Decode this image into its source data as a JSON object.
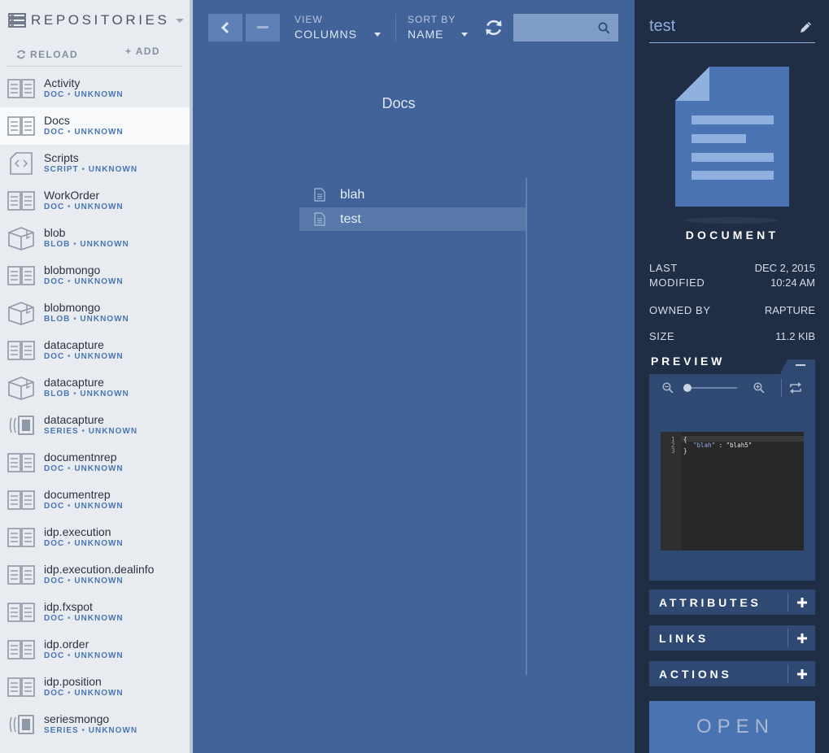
{
  "sidebar": {
    "title": "REPOSITORIES",
    "reload_label": "RELOAD",
    "add_label": "+ ADD",
    "items": [
      {
        "name": "Activity",
        "type": "DOC",
        "status": "UNKNOWN",
        "icon": "doc-repo-icon"
      },
      {
        "name": "Docs",
        "type": "DOC",
        "status": "UNKNOWN",
        "icon": "doc-repo-icon",
        "selected": true
      },
      {
        "name": "Scripts",
        "type": "SCRIPT",
        "status": "UNKNOWN",
        "icon": "script-repo-icon"
      },
      {
        "name": "WorkOrder",
        "type": "DOC",
        "status": "UNKNOWN",
        "icon": "doc-repo-icon"
      },
      {
        "name": "blob",
        "type": "BLOB",
        "status": "UNKNOWN",
        "icon": "blob-repo-icon"
      },
      {
        "name": "blobmongo",
        "type": "DOC",
        "status": "UNKNOWN",
        "icon": "doc-repo-icon"
      },
      {
        "name": "blobmongo",
        "type": "BLOB",
        "status": "UNKNOWN",
        "icon": "blob-repo-icon"
      },
      {
        "name": "datacapture",
        "type": "DOC",
        "status": "UNKNOWN",
        "icon": "doc-repo-icon"
      },
      {
        "name": "datacapture",
        "type": "BLOB",
        "status": "UNKNOWN",
        "icon": "blob-repo-icon"
      },
      {
        "name": "datacapture",
        "type": "SERIES",
        "status": "UNKNOWN",
        "icon": "series-repo-icon"
      },
      {
        "name": "documentnrep",
        "type": "DOC",
        "status": "UNKNOWN",
        "icon": "doc-repo-icon"
      },
      {
        "name": "documentrep",
        "type": "DOC",
        "status": "UNKNOWN",
        "icon": "doc-repo-icon"
      },
      {
        "name": "idp.execution",
        "type": "DOC",
        "status": "UNKNOWN",
        "icon": "doc-repo-icon"
      },
      {
        "name": "idp.execution.dealinfo",
        "type": "DOC",
        "status": "UNKNOWN",
        "icon": "doc-repo-icon"
      },
      {
        "name": "idp.fxspot",
        "type": "DOC",
        "status": "UNKNOWN",
        "icon": "doc-repo-icon"
      },
      {
        "name": "idp.order",
        "type": "DOC",
        "status": "UNKNOWN",
        "icon": "doc-repo-icon"
      },
      {
        "name": "idp.position",
        "type": "DOC",
        "status": "UNKNOWN",
        "icon": "doc-repo-icon"
      },
      {
        "name": "seriesmongo",
        "type": "SERIES",
        "status": "UNKNOWN",
        "icon": "series-repo-icon"
      }
    ],
    "meta_separator": "•"
  },
  "toolbar": {
    "view_label": "VIEW",
    "view_value": "COLUMNS",
    "sort_label": "SORT BY",
    "sort_value": "NAME",
    "search_placeholder": ""
  },
  "main": {
    "column_title": "Docs",
    "files": [
      {
        "name": "blah",
        "selected": false
      },
      {
        "name": "test",
        "selected": true
      }
    ]
  },
  "panel": {
    "title": "test",
    "doc_type": "DOCUMENT",
    "last_modified_label_1": "LAST",
    "last_modified_label_2": "MODIFIED",
    "last_modified_date": "DEC 2, 2015",
    "last_modified_time": "10:24 AM",
    "owned_by_label": "OWNED BY",
    "owned_by_value": "RAPTURE",
    "size_label": "SIZE",
    "size_value": "11.2 KIB",
    "preview_label": "PREVIEW",
    "preview_zoom": 0,
    "preview_code": {
      "line_numbers": [
        "1",
        "2",
        "3"
      ],
      "line1": "{",
      "line2_key": "\"blah\"",
      "line2_colon": " : ",
      "line2_value": "\"blah5\"",
      "line3": "}"
    },
    "attributes_label": "ATTRIBUTES",
    "links_label": "LINKS",
    "actions_label": "ACTIONS",
    "open_label": "OPEN"
  },
  "colors": {
    "main_bg": "#41639a",
    "sidebar_bg": "#e8ecf1",
    "panel_bg": "#1f2d45",
    "accent": "#4a76b1"
  }
}
